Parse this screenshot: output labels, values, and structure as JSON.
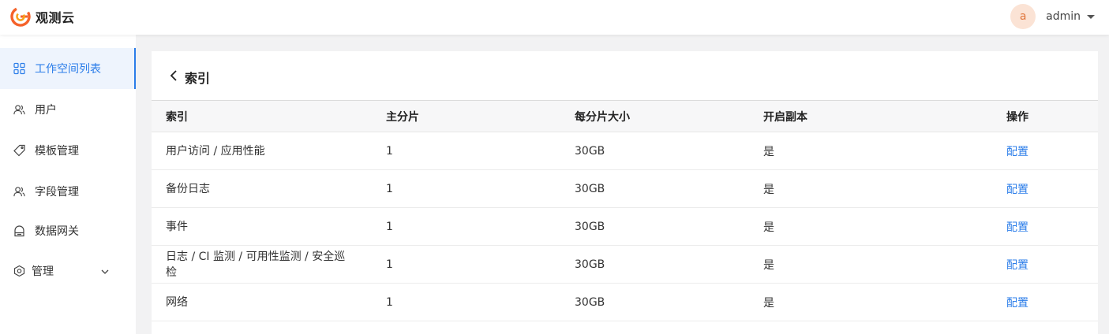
{
  "header": {
    "logo_text": "观测云",
    "brand_color": "#f5622a",
    "avatar_letter": "a",
    "username": "admin"
  },
  "sidebar": {
    "items": [
      {
        "label": "工作空间列表",
        "icon": "grid-icon",
        "active": true
      },
      {
        "label": "用户",
        "icon": "users-icon"
      },
      {
        "label": "模板管理",
        "icon": "tag-icon"
      },
      {
        "label": "字段管理",
        "icon": "users-icon"
      },
      {
        "label": "数据网关",
        "icon": "gateway-icon"
      },
      {
        "label": "管理",
        "icon": "settings-icon",
        "expandable": true
      }
    ]
  },
  "main": {
    "title": "索引",
    "table": {
      "columns": [
        "索引",
        "主分片",
        "每分片大小",
        "开启副本",
        "操作"
      ],
      "rows": [
        {
          "index": "用户访问 / 应用性能",
          "primary_shards": "1",
          "shard_size": "30GB",
          "replica": "是",
          "action": "配置"
        },
        {
          "index": "备份日志",
          "primary_shards": "1",
          "shard_size": "30GB",
          "replica": "是",
          "action": "配置"
        },
        {
          "index": "事件",
          "primary_shards": "1",
          "shard_size": "30GB",
          "replica": "是",
          "action": "配置"
        },
        {
          "index": "日志 / CI 监测 / 可用性监测 / 安全巡检",
          "primary_shards": "1",
          "shard_size": "30GB",
          "replica": "是",
          "action": "配置"
        },
        {
          "index": "网络",
          "primary_shards": "1",
          "shard_size": "30GB",
          "replica": "是",
          "action": "配置"
        }
      ]
    }
  },
  "colors": {
    "accent": "#2b7de9",
    "avatar_bg": "#fbe3d5"
  }
}
